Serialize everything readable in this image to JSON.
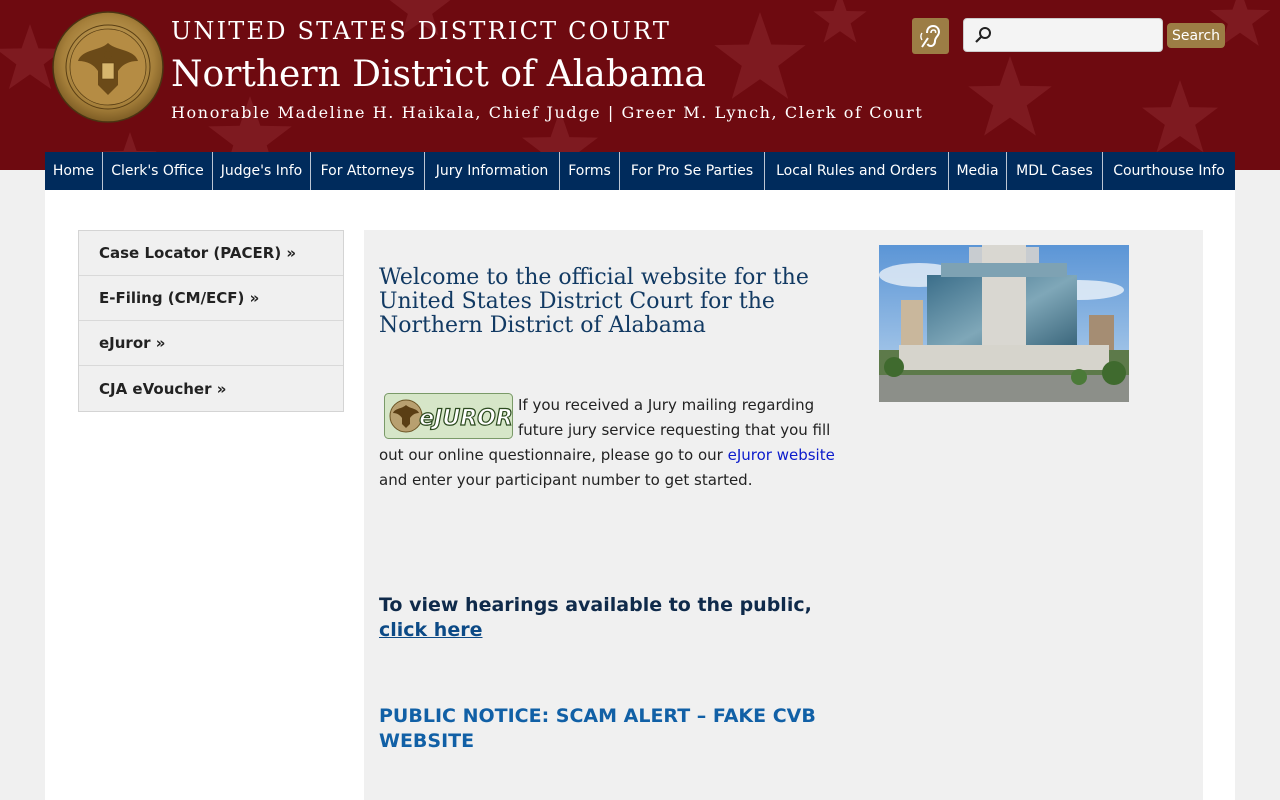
{
  "header": {
    "line1": "UNITED STATES DISTRICT COURT",
    "line2": "Northern District of Alabama",
    "line3": "Honorable Madeline H. Haikala, Chief Judge | Greer M. Lynch, Clerk of Court",
    "seal_text": "UNITED STATES DISTRICT COURT · NORTHERN DISTRICT OF ALABAMA",
    "background_color": "#6e0a10",
    "accent_color": "#9c7d45"
  },
  "search": {
    "placeholder": "",
    "value": "",
    "button_label": "Search"
  },
  "nav": {
    "items": [
      {
        "label": "Home"
      },
      {
        "label": "Clerk's Office"
      },
      {
        "label": "Judge's Info"
      },
      {
        "label": "For Attorneys"
      },
      {
        "label": "Jury Information"
      },
      {
        "label": "Forms"
      },
      {
        "label": "For Pro Se Parties"
      },
      {
        "label": "Local Rules and Orders"
      },
      {
        "label": "Media"
      },
      {
        "label": "MDL Cases"
      },
      {
        "label": "Courthouse Info"
      }
    ],
    "background_color": "#002b5c"
  },
  "sidebar": {
    "items": [
      {
        "label": "Case Locator (PACER) »"
      },
      {
        "label": "E-Filing (CM/ECF) »"
      },
      {
        "label": "eJuror »"
      },
      {
        "label": "CJA eVoucher »"
      }
    ]
  },
  "main": {
    "welcome": "Welcome to the official website for the United States District Court for the Northern District of Alabama",
    "ejuror_badge_text": "eJUROR",
    "jury_text_1": "If you received a Jury mailing regarding future jury service requesting that you fill out our online questionnaire, please go to our ",
    "jury_link": "eJuror website",
    "jury_text_2": " and enter your participant number to get started.",
    "hearings_text": "To view hearings available to the public,",
    "hearings_link": "click here",
    "notice": "PUBLIC NOTICE: SCAM ALERT – FAKE CVB WEBSITE"
  },
  "icons": {
    "accessibility": "hearing-accessibility-icon",
    "search": "magnifier-icon"
  }
}
